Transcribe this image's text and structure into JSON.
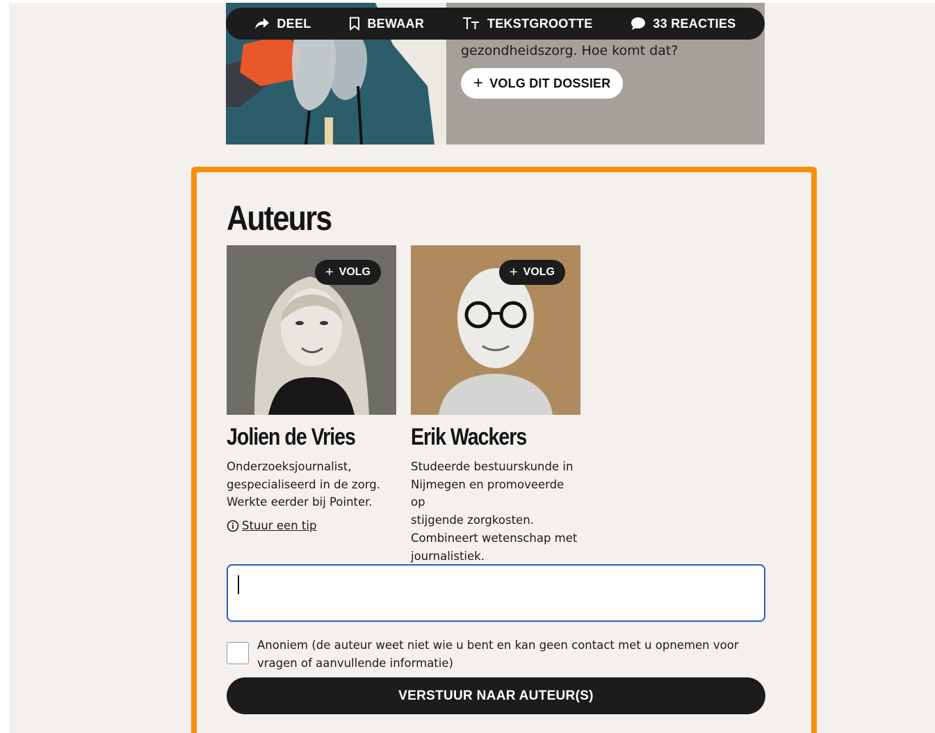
{
  "toolbar": {
    "share_label": "DEEL",
    "save_label": "BEWAAR",
    "textsize_label": "TEKSTGROOTTE",
    "comments_label": "33 REACTIES"
  },
  "hero": {
    "description": "gezondheidszorg. Hoe komt dat?",
    "follow_dossier_label": "VOLG DIT DOSSIER"
  },
  "authors": {
    "title": "Auteurs",
    "follow_label": "VOLG",
    "items": [
      {
        "name": "Jolien de Vries",
        "bio": [
          "Onderzoeksjournalist,",
          "gespecialiseerd in de zorg.",
          "Werkte eerder bij Pointer."
        ],
        "tip_label": "Stuur een tip"
      },
      {
        "name": "Erik Wackers",
        "bio": [
          "Studeerde bestuurskunde in",
          "Nijmegen en promoveerde op",
          "stijgende zorgkosten.",
          "Combineert wetenschap met",
          "journalistiek."
        ]
      }
    ]
  },
  "tip_form": {
    "input_value": "",
    "anonymous_label_line1": "Anoniem (de auteur weet niet wie u bent en kan geen contact met u opnemen voor",
    "anonymous_label_line2": "vragen of aanvullende informatie)",
    "anonymous_checked": false,
    "submit_label": "VERSTUUR NAAR AUTEUR(S)"
  },
  "colors": {
    "page_bg": "#f3f0ed",
    "accent_border": "#f5900b",
    "toolbar_bg": "#1c1c1c",
    "input_focus_border": "#2b5fc0"
  }
}
